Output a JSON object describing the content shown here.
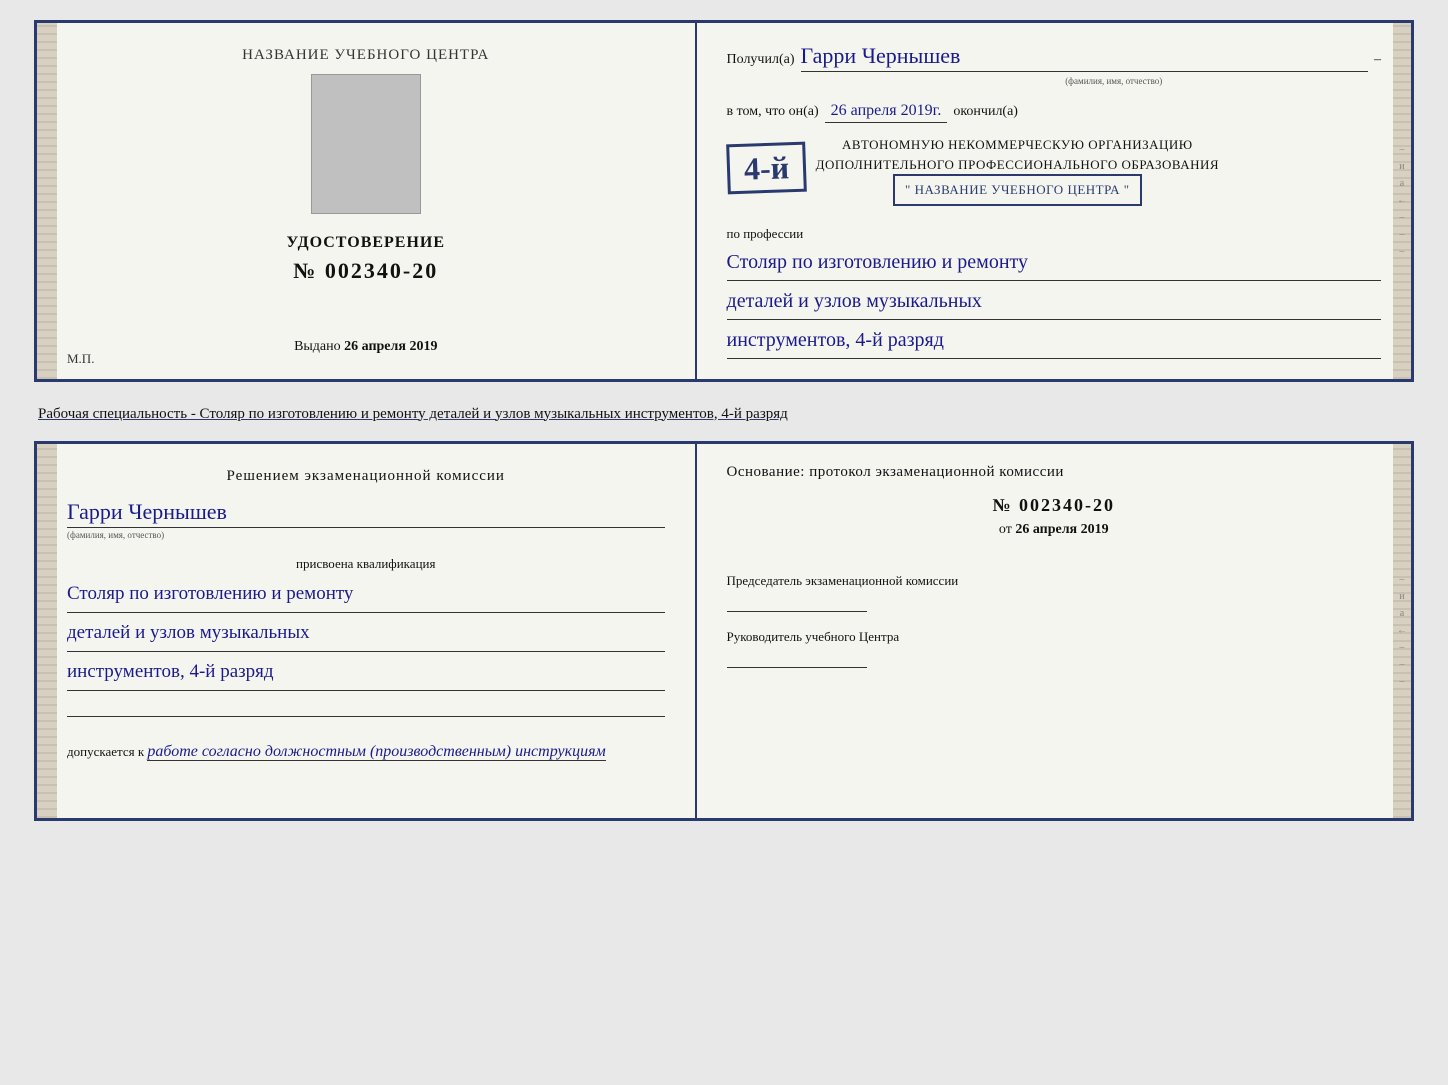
{
  "top_doc": {
    "left": {
      "center_title": "НАЗВАНИЕ УЧЕБНОГО ЦЕНТРА",
      "cert_label": "УДОСТОВЕРЕНИЕ",
      "cert_number": "№ 002340-20",
      "issued_label": "Выдано",
      "issued_date": "26 апреля 2019",
      "mp_label": "М.П."
    },
    "right": {
      "received_prefix": "Получил(а)",
      "recipient_name": "Гарри Чернышев",
      "name_subtitle": "(фамилия, имя, отчество)",
      "dash1": "–",
      "intom_prefix": "в том, что он(а)",
      "intom_date": "26 апреля 2019г.",
      "okoncil": "окончил(а)",
      "grade_text": "4-й",
      "org_line1": "АВТОНОМНУЮ НЕКОММЕРЧЕСКУЮ ОРГАНИЗАЦИЮ",
      "org_line2": "ДОПОЛНИТЕЛЬНОГО ПРОФЕССИОНАЛЬНОГО ОБРАЗОВАНИЯ",
      "org_name": "\" НАЗВАНИЕ УЧЕБНОГО ЦЕНТРА \"",
      "profession_label": "по профессии",
      "profession_line1": "Столяр по изготовлению и ремонту",
      "profession_line2": "деталей и узлов музыкальных",
      "profession_line3": "инструментов, 4-й разряд",
      "side_chars": [
        "и",
        "а",
        "←",
        "–",
        "–",
        "–",
        "–"
      ]
    }
  },
  "subtitle": "Рабочая специальность - Столяр по изготовлению и ремонту деталей и узлов музыкальных инструментов, 4-й разряд",
  "bottom_doc": {
    "left": {
      "commission_title": "Решением экзаменационной комиссии",
      "name_handwritten": "Гарри Чернышев",
      "name_subtitle": "(фамилия, имя, отчество)",
      "assigned_text": "присвоена квалификация",
      "qual_line1": "Столяр по изготовлению и ремонту",
      "qual_line2": "деталей и узлов музыкальных",
      "qual_line3": "инструментов, 4-й разряд",
      "allow_prefix": "допускается к",
      "allow_text": "работе согласно должностным (производственным) инструкциям"
    },
    "right": {
      "basis_title": "Основание: протокол экзаменационной комиссии",
      "protocol_number": "№ 002340-20",
      "protocol_date_prefix": "от",
      "protocol_date": "26 апреля 2019",
      "chairman_label": "Председатель экзаменационной комиссии",
      "director_label": "Руководитель учебного Центра",
      "side_chars": [
        "и",
        "а",
        "←",
        "–",
        "–",
        "–",
        "–"
      ]
    }
  }
}
